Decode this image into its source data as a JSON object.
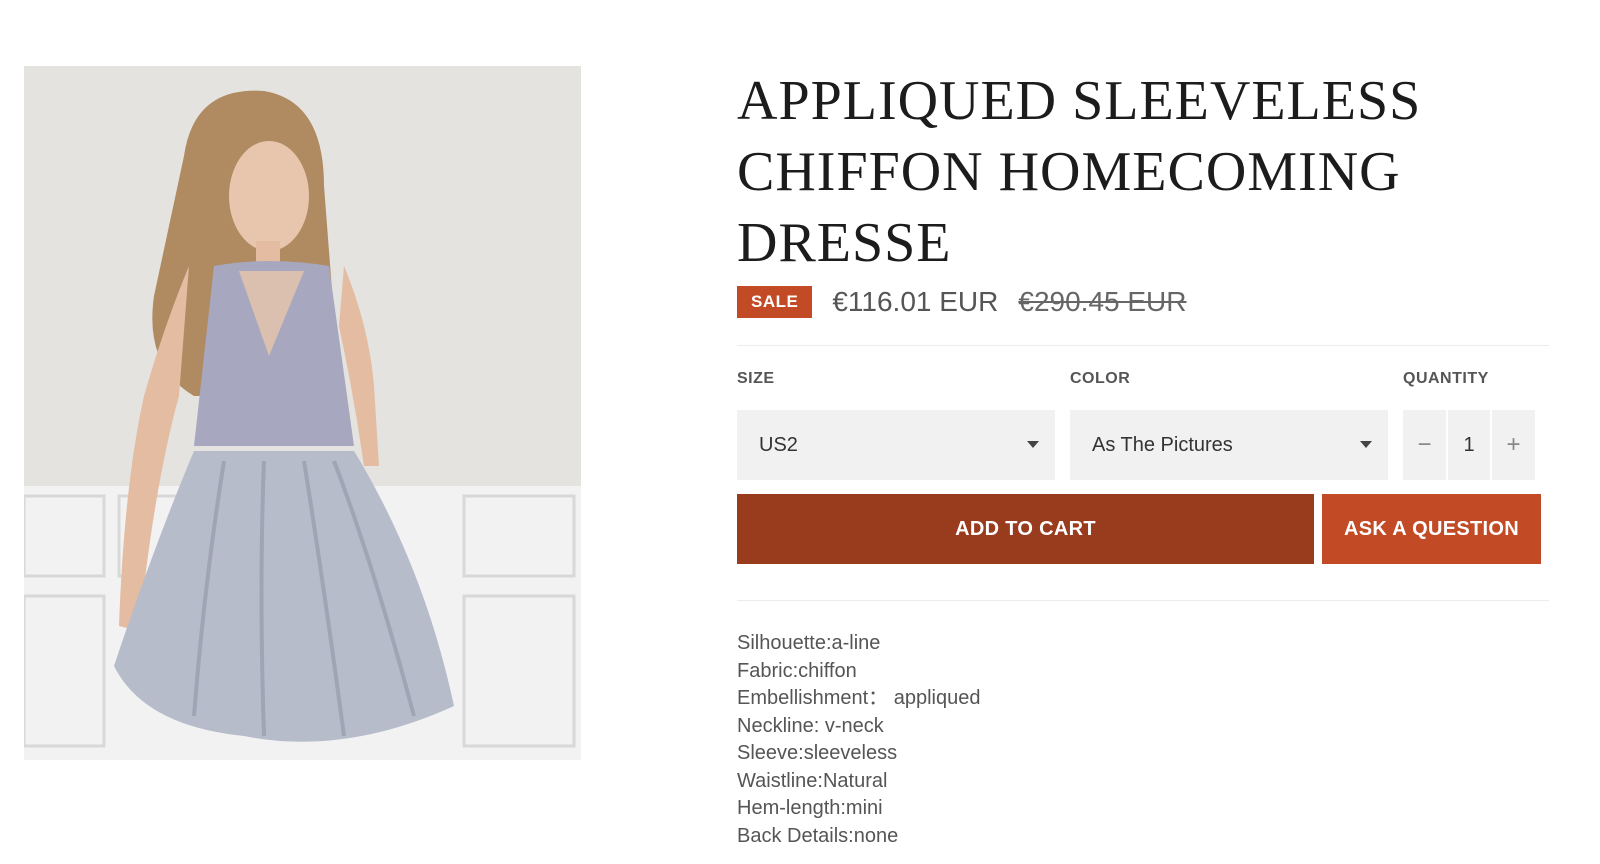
{
  "product": {
    "title": "APPLIQUED SLEEVELESS CHIFFON HOMECOMING DRESSE",
    "sale_badge": "SALE",
    "price": "€116.01 EUR",
    "compare_price": "€290.45 EUR"
  },
  "options": {
    "size_label": "SIZE",
    "size_value": "US2",
    "color_label": "COLOR",
    "color_value": "As The Pictures",
    "quantity_label": "QUANTITY",
    "quantity_value": "1",
    "minus_symbol": "−",
    "plus_symbol": "+"
  },
  "actions": {
    "add_to_cart": "ADD TO CART",
    "ask_question": "ASK A QUESTION"
  },
  "specs": [
    "Silhouette:a-line",
    "Fabric:chiffon",
    "Embellishment： appliqued",
    "Neckline: v-neck",
    "Sleeve:sleeveless",
    "Waistline:Natural",
    "Hem-length:mini",
    "Back Details:none"
  ],
  "colors": {
    "sale": "#c24a24",
    "add_to_cart": "#993b1d",
    "ask_question": "#c24a24",
    "field_bg": "#f1f1f1"
  }
}
